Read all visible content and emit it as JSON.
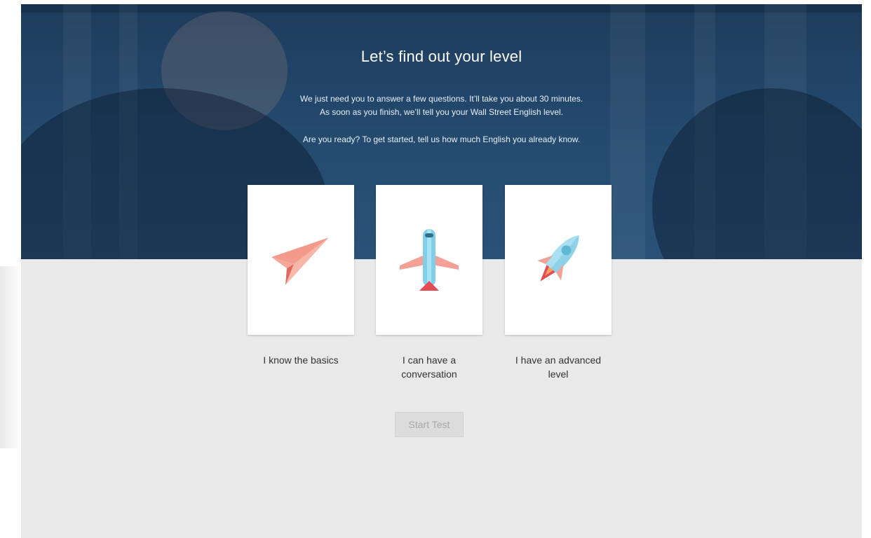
{
  "hero": {
    "title": "Let’s find out your level",
    "intro_line1": "We just need you to answer a few questions. It’ll take you about 30 minutes.",
    "intro_line2": "As soon as you finish, we’ll tell you your Wall Street English level.",
    "prompt": "Are you ready? To get started, tell us how much English you already know."
  },
  "levels": [
    {
      "label": "I know the basics",
      "icon": "paper-plane-icon"
    },
    {
      "label_line1": "I can have a",
      "label_line2": "conversation",
      "icon": "airplane-icon"
    },
    {
      "label_line1": "I have an advanced",
      "label_line2": "level",
      "icon": "rocket-icon"
    }
  ],
  "start_button": {
    "label": "Start Test",
    "state": "disabled"
  },
  "colors": {
    "hero_overlay": "#244a6e",
    "background": "#e9e9e9",
    "card": "#ffffff",
    "accent_coral": "#f08a7e",
    "accent_blue": "#7fcfe8",
    "button_disabled": "#dcdcdc"
  }
}
